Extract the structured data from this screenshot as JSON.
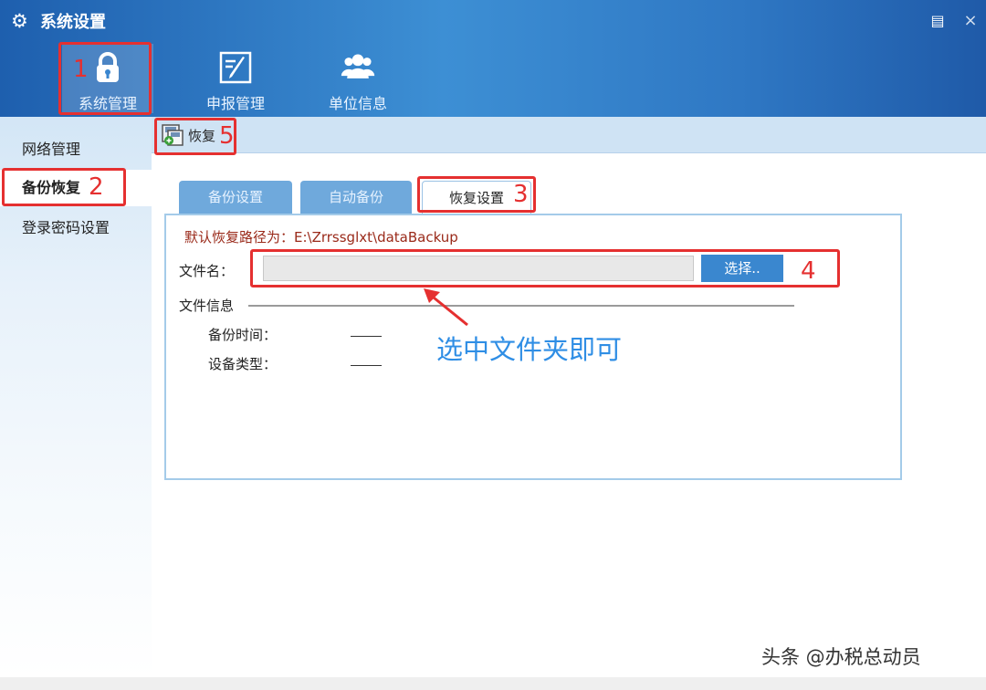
{
  "header": {
    "title": "系统设置",
    "title_icon": "gear-icon",
    "window_controls": [
      "restore-icon",
      "close-icon"
    ],
    "close_glyph": "×",
    "restore_glyph": "▤",
    "nav": [
      {
        "label": "系统管理",
        "icon": "lock-icon",
        "active": true
      },
      {
        "label": "申报管理",
        "icon": "edit-icon",
        "active": false
      },
      {
        "label": "单位信息",
        "icon": "users-icon",
        "active": false
      }
    ]
  },
  "sidebar": {
    "items": [
      {
        "label": "网络管理",
        "active": false
      },
      {
        "label": "备份恢复",
        "active": true
      },
      {
        "label": "登录密码设置",
        "active": false
      }
    ]
  },
  "toolbar": {
    "restore_label": "恢复",
    "restore_icon": "restore-icon"
  },
  "tabs": [
    {
      "label": "备份设置",
      "active": false
    },
    {
      "label": "自动备份",
      "active": false
    },
    {
      "label": "恢复设置",
      "active": true
    }
  ],
  "form": {
    "default_path": "默认恢复路径为：E:\\Zrrssglxt\\dataBackup",
    "file_label": "文件名：",
    "file_value": "",
    "select_button": "选择..",
    "info_label": "文件信息",
    "backup_time_label": "备份时间：",
    "backup_time_value": "——",
    "device_type_label": "设备类型：",
    "device_type_value": "——"
  },
  "annotations": {
    "numbers": [
      "1",
      "2",
      "3",
      "4",
      "5"
    ],
    "hint": "选中文件夹即可",
    "color": "#e53030",
    "hint_color": "#2f8ee5"
  },
  "watermark": "头条 @办税总动员"
}
